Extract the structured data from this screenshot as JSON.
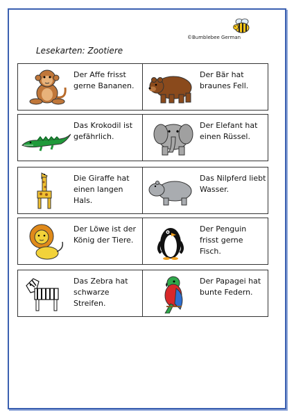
{
  "logo": {
    "text": "©Bumblebee German",
    "icon": "bee-icon"
  },
  "title": "Lesekarten: Zootiere",
  "cards": [
    {
      "text": "Der Affe frisst gerne Bananen.",
      "icon": "monkey-icon"
    },
    {
      "text": "Der Bär hat braunes Fell.",
      "icon": "bear-icon"
    },
    {
      "text": "Das Krokodil ist gefährlich.",
      "icon": "crocodile-icon"
    },
    {
      "text": "Der Elefant hat einen Rüssel.",
      "icon": "elephant-icon"
    },
    {
      "text": "Die Giraffe hat einen langen Hals.",
      "icon": "giraffe-icon"
    },
    {
      "text": "Das Nilpferd liebt Wasser.",
      "icon": "hippo-icon"
    },
    {
      "text": "Der Löwe ist der König der Tiere.",
      "icon": "lion-icon"
    },
    {
      "text": "Der Penguin frisst gerne Fisch.",
      "icon": "penguin-icon"
    },
    {
      "text": "Das Zebra hat schwarze Streifen.",
      "icon": "zebra-icon"
    },
    {
      "text": "Der Papagei hat bunte Federn.",
      "icon": "parrot-icon"
    }
  ]
}
